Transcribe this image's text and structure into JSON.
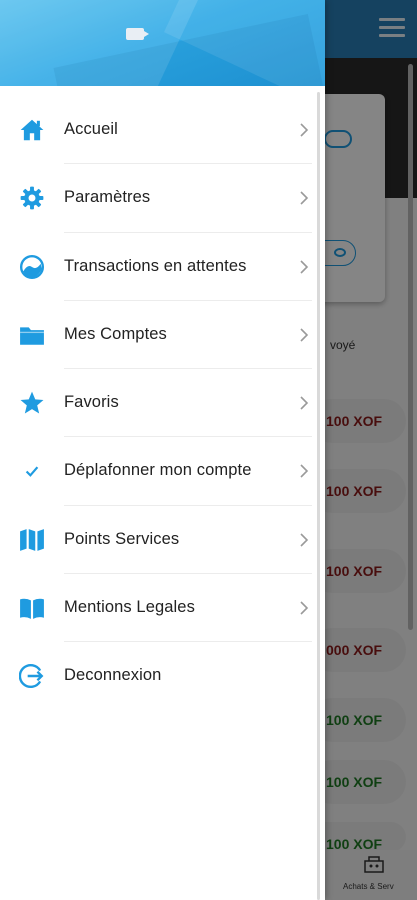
{
  "colors": {
    "accent": "#1f9be0",
    "header_gradient_start": "#59c1ee",
    "header_gradient_end": "#1f97d9",
    "amount_out": "#8b1a1a",
    "amount_in": "#1e7a23"
  },
  "drawer": {
    "logo_icon": "card-icon",
    "items": [
      {
        "label": "Accueil",
        "icon": "home-icon",
        "chevron": true
      },
      {
        "label": "Paramètres",
        "icon": "gear-icon",
        "chevron": true
      },
      {
        "label": "Transactions en attentes",
        "icon": "clock-icon",
        "chevron": true
      },
      {
        "label": "Mes Comptes",
        "icon": "folder-icon",
        "chevron": true
      },
      {
        "label": "Favoris",
        "icon": "star-icon",
        "chevron": true
      },
      {
        "label": "Déplafonner mon compte",
        "icon": "check-icon",
        "chevron": true
      },
      {
        "label": "Points Services",
        "icon": "map-icon",
        "chevron": true
      },
      {
        "label": "Mentions Legales",
        "icon": "book-icon",
        "chevron": true
      },
      {
        "label": "Deconnexion",
        "icon": "logout-icon",
        "chevron": false
      }
    ]
  },
  "background": {
    "sent_label": "voyé",
    "transactions": [
      {
        "amount": "100 XOF",
        "kind": "out"
      },
      {
        "amount": "100 XOF",
        "kind": "out"
      },
      {
        "amount": "100 XOF",
        "kind": "out"
      },
      {
        "amount": "000 XOF",
        "kind": "out"
      },
      {
        "amount": "100 XOF",
        "kind": "in"
      },
      {
        "amount": "100 XOF",
        "kind": "in"
      },
      {
        "amount": "100 XOF",
        "kind": "in"
      }
    ],
    "bottom_tab_label": "Achats & Serv"
  }
}
